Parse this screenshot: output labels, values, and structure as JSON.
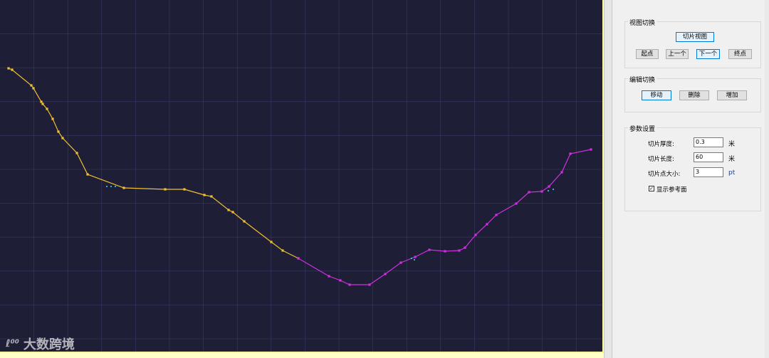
{
  "panel": {
    "view_switch": {
      "title": "视图切换",
      "slice_view": "切片视图",
      "start": "起点",
      "prev": "上一个",
      "next": "下一个",
      "end": "终点"
    },
    "edit_switch": {
      "title": "编辑切换",
      "move": "移动",
      "delete": "删除",
      "add": "增加"
    },
    "params": {
      "title": "参数设置",
      "thickness_label": "切片厚度:",
      "thickness_value": "0.3",
      "thickness_unit": "米",
      "length_label": "切片长度:",
      "length_value": "60",
      "length_unit": "米",
      "point_size_label": "切片点大小:",
      "point_size_value": "3",
      "point_size_unit": "pt",
      "show_ref_plane_label": "显示参考面",
      "show_ref_plane_checked": true
    }
  },
  "watermark": {
    "text": "大数跨境"
  },
  "profile": {
    "colors": {
      "background": "#1e1e36",
      "grid": "#3a3a66",
      "segment_a": "#f0c030",
      "segment_b": "#d030e0",
      "noise": "#30b0e0"
    },
    "segment_a": [
      [
        12,
        96
      ],
      [
        17,
        98
      ],
      [
        44,
        120
      ],
      [
        47,
        124
      ],
      [
        58,
        143
      ],
      [
        60,
        146
      ],
      [
        66,
        153
      ],
      [
        74,
        167
      ],
      [
        82,
        185
      ],
      [
        88,
        194
      ],
      [
        108,
        215
      ],
      [
        123,
        245
      ],
      [
        174,
        264
      ],
      [
        232,
        266
      ],
      [
        259,
        266
      ],
      [
        287,
        274
      ],
      [
        297,
        276
      ],
      [
        321,
        295
      ],
      [
        327,
        298
      ],
      [
        343,
        311
      ],
      [
        381,
        340
      ],
      [
        397,
        352
      ],
      [
        419,
        363
      ]
    ],
    "segment_b": [
      [
        419,
        363
      ],
      [
        462,
        388
      ],
      [
        478,
        394
      ],
      [
        491,
        400
      ],
      [
        519,
        400
      ],
      [
        541,
        385
      ],
      [
        563,
        369
      ],
      [
        583,
        361
      ],
      [
        603,
        351
      ],
      [
        625,
        353
      ],
      [
        645,
        352
      ],
      [
        653,
        348
      ],
      [
        668,
        330
      ],
      [
        684,
        315
      ],
      [
        697,
        302
      ],
      [
        725,
        286
      ],
      [
        743,
        270
      ],
      [
        761,
        269
      ],
      [
        771,
        262
      ],
      [
        789,
        242
      ],
      [
        801,
        216
      ],
      [
        830,
        210
      ]
    ],
    "noise_points": [
      [
        150,
        262
      ],
      [
        156,
        262
      ],
      [
        162,
        262
      ],
      [
        578,
        363
      ],
      [
        582,
        365
      ],
      [
        770,
        268
      ],
      [
        777,
        266
      ]
    ]
  }
}
